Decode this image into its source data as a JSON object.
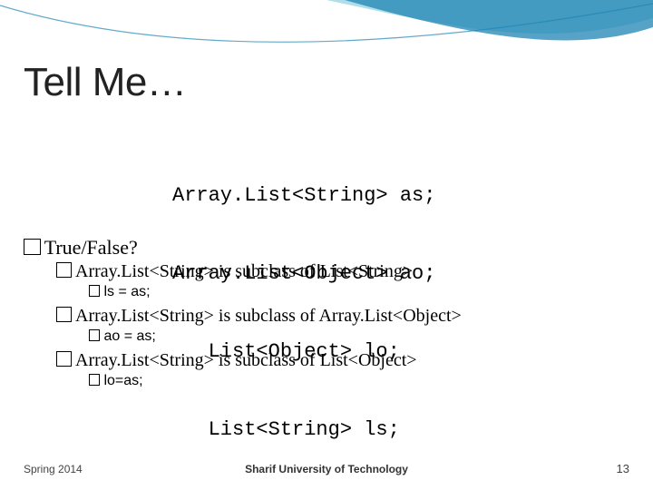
{
  "title": "Tell Me…",
  "code": {
    "l1": "Array.List<String> as;",
    "l2": "Array.List<Object> ao;",
    "l3": "   List<Object> lo;",
    "l4": "   List<String> ls;"
  },
  "tf_label": "True/False?",
  "items": [
    {
      "claim": "Array.List<String> is subclass of List<String>",
      "example": "ls = as;"
    },
    {
      "claim": "Array.List<String> is subclass of Array.List<Object>",
      "example": "ao = as;"
    },
    {
      "claim": "Array.List<String> is subclass of List<Object>",
      "example": "lo=as;"
    }
  ],
  "footer": {
    "left": "Spring 2014",
    "center": "Sharif University of Technology",
    "page": "13"
  },
  "colors": {
    "swoosh1": "#1f84b4",
    "swoosh2": "#6fc3d6"
  }
}
